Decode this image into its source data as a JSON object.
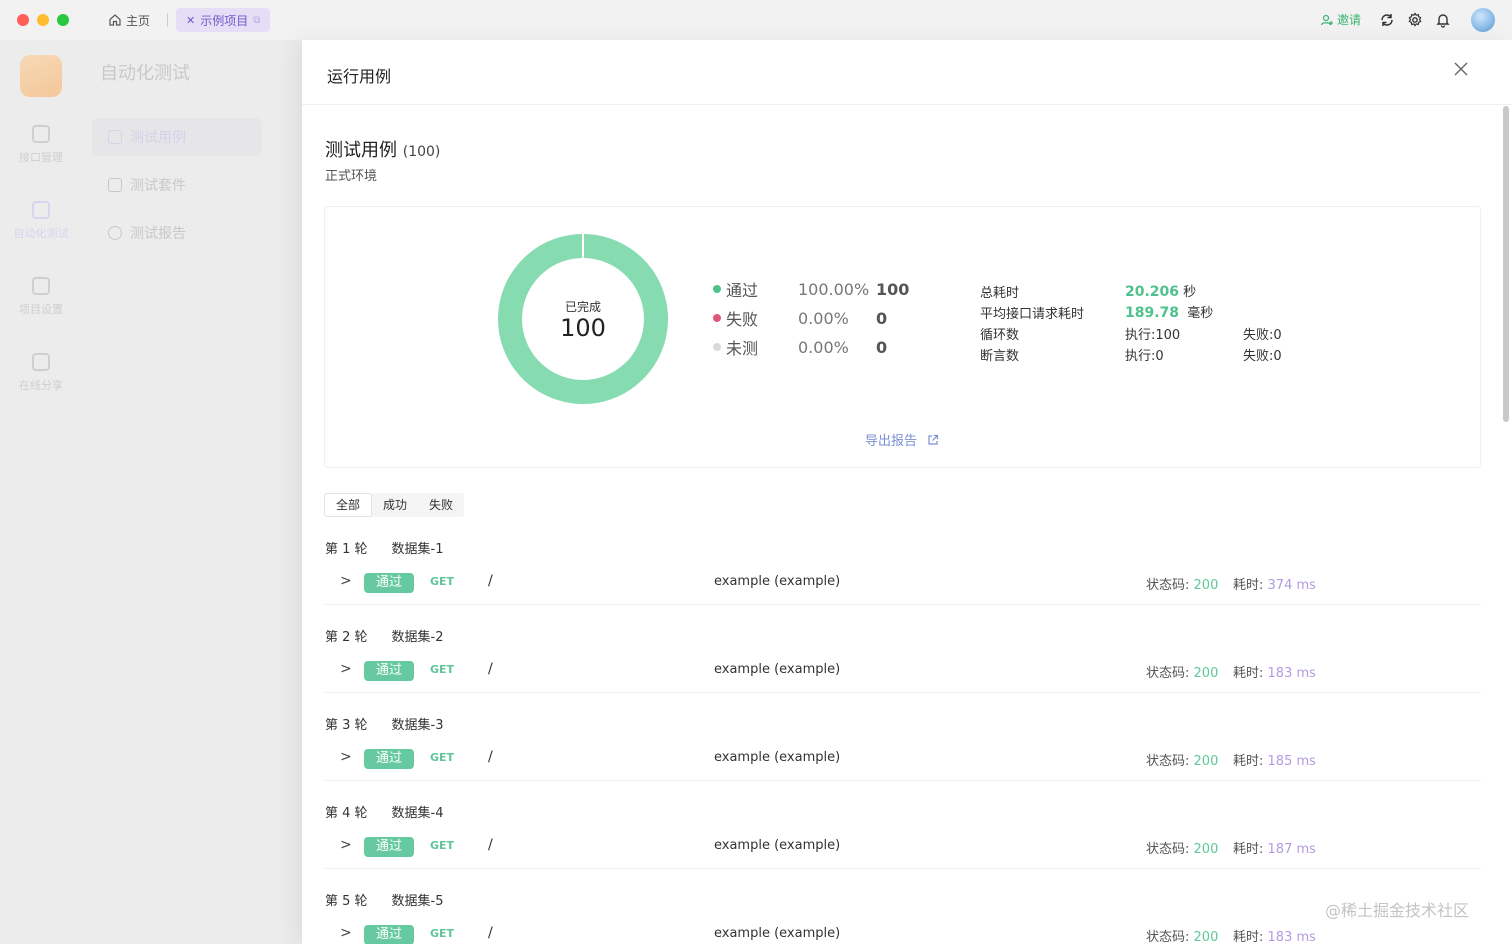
{
  "titlebar": {
    "home_label": "主页",
    "project_tab_label": "示例项目",
    "invite_label": "邀请",
    "icons": [
      "sync-icon",
      "gear-icon",
      "bell-icon"
    ]
  },
  "sidebar": {
    "title": "自动化测试",
    "rail": [
      {
        "label": "接口管理"
      },
      {
        "label": "自动化测试"
      },
      {
        "label": "项目设置"
      },
      {
        "label": "在线分享"
      }
    ],
    "items": [
      {
        "label": "测试用例"
      },
      {
        "label": "测试套件"
      },
      {
        "label": "测试报告"
      }
    ]
  },
  "drawer": {
    "title": "运行用例",
    "section_title": "测试用例",
    "section_count": "(100)",
    "environment": "正式环境",
    "donut": {
      "label": "已完成",
      "value": "100",
      "pass_fraction": 1.0,
      "pass_color": "#86dcb0"
    },
    "legend": [
      {
        "name": "通过",
        "pct": "100.00%",
        "count": "100",
        "color": "#4fc18d"
      },
      {
        "name": "失败",
        "pct": "0.00%",
        "count": "0",
        "color": "#e0577a"
      },
      {
        "name": "未测",
        "pct": "0.00%",
        "count": "0",
        "color": "#d9d9d9"
      }
    ],
    "stats": {
      "total_time_label": "总耗时",
      "total_time_value": "20.206",
      "total_time_unit": "秒",
      "avg_label": "平均接口请求耗时",
      "avg_value": "189.78",
      "avg_unit": "毫秒",
      "loop_label": "循环数",
      "loop_exec": "执行:100",
      "loop_fail": "失败:0",
      "assert_label": "断言数",
      "assert_exec": "执行:0",
      "assert_fail": "失败:0"
    },
    "export_label": "导出报告",
    "filters": [
      "全部",
      "成功",
      "失败"
    ],
    "status_label": "状态码:",
    "elapsed_label": "耗时:",
    "rounds": [
      {
        "round": "第 1 轮",
        "dataset": "数据集-1",
        "badge": "通过",
        "method": "GET",
        "path": "/",
        "name": "example (example)",
        "status": "200",
        "elapsed": "374 ms"
      },
      {
        "round": "第 2 轮",
        "dataset": "数据集-2",
        "badge": "通过",
        "method": "GET",
        "path": "/",
        "name": "example (example)",
        "status": "200",
        "elapsed": "183 ms"
      },
      {
        "round": "第 3 轮",
        "dataset": "数据集-3",
        "badge": "通过",
        "method": "GET",
        "path": "/",
        "name": "example (example)",
        "status": "200",
        "elapsed": "185 ms"
      },
      {
        "round": "第 4 轮",
        "dataset": "数据集-4",
        "badge": "通过",
        "method": "GET",
        "path": "/",
        "name": "example (example)",
        "status": "200",
        "elapsed": "187 ms"
      },
      {
        "round": "第 5 轮",
        "dataset": "数据集-5",
        "badge": "通过",
        "method": "GET",
        "path": "/",
        "name": "example (example)",
        "status": "200",
        "elapsed": "183 ms"
      }
    ]
  },
  "watermark": "@稀土掘金技术社区"
}
